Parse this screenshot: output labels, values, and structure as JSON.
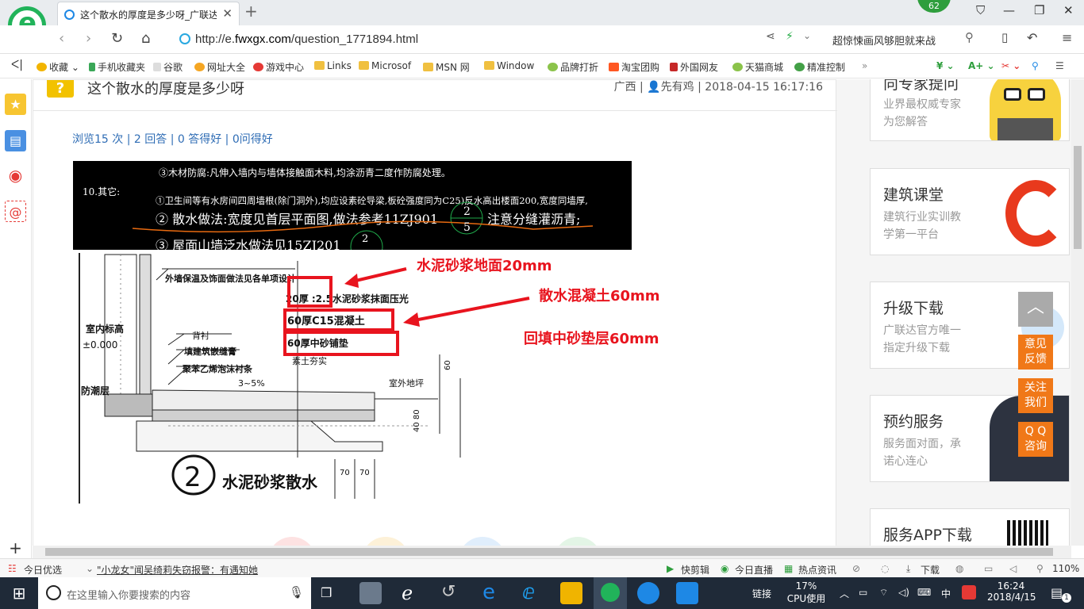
{
  "browser": {
    "tab_title": "这个散水的厚度是多少呀_广联达",
    "badge_count": "62",
    "url_prefix": "http://e.",
    "url_host": "fwxgx.com",
    "url_path": "/question_1771894.html",
    "search_text": "超惊悚画风够胆就来战"
  },
  "bookmarks": [
    {
      "label": "收藏"
    },
    {
      "label": "手机收藏夹"
    },
    {
      "label": "谷歌"
    },
    {
      "label": "网址大全"
    },
    {
      "label": "游戏中心"
    },
    {
      "label": "Links"
    },
    {
      "label": "Microsof"
    },
    {
      "label": "MSN 网"
    },
    {
      "label": "Window"
    },
    {
      "label": "品牌打折"
    },
    {
      "label": "淘宝团购"
    },
    {
      "label": "外国网友"
    },
    {
      "label": "天猫商城"
    },
    {
      "label": "精准控制"
    }
  ],
  "question": {
    "icon": "?",
    "title": "这个散水的厚度是多少呀",
    "region": "广西",
    "user": "先有鸡",
    "datetime": "2018-04-15 16:17:16",
    "stats": "浏览15 次 | 2 回答 | 0 答得好 | 0问得好"
  },
  "drawing": {
    "top_lines": [
      "③木材防腐:凡伸入墙内与墙体接触面木料,均涂沥青二度作防腐处理。",
      "10.其它:",
      "①卫生间等有水房间四周墙根(除门洞外),均应设素砼导梁,板砼强度同为C25)反水高出楼面200,宽度同墙厚,",
      "② 散水做法:宽度见首层平面图,做法参考11ZJ901",
      "注意分缝灌沥青;",
      "③ 屋面山墙泛水做法见15ZJ201"
    ],
    "ref_num": "2",
    "ref_den": "5",
    "ref2_num": "2",
    "detail_labels": {
      "wall_note": "外墙保温及饰面做法见各单项设计",
      "layer1": "20厚 :2.5水泥砂浆抹面压光",
      "layer2": "60厚C15混凝土",
      "layer3": "60厚中砂铺垫",
      "soil": "素土夯实",
      "indoor": "室内标高",
      "zero": "±0.000",
      "damp": "防潮层",
      "backing": "背衬",
      "sealant": "填建筑嵌缝膏",
      "foam": "聚苯乙烯泡沫衬条",
      "slope": "3~5%",
      "outdoor": "室外地坪",
      "dim1": "70",
      "dim2": "70",
      "dim_right1": "60",
      "dim_right2": "40 80",
      "circle_num": "2",
      "caption": "水泥砂浆散水"
    },
    "annotations": {
      "a1": "水泥砂浆地面20mm",
      "a2": "散水混凝土60mm",
      "a3": "回填中砂垫层60mm"
    },
    "red": "#e8141e"
  },
  "sidebar": {
    "cards": [
      {
        "title": "向专家提问",
        "sub1": "业界最权威专家",
        "sub2": "为您解答"
      },
      {
        "title": "建筑课堂",
        "sub1": "建筑行业实训教",
        "sub2": "学第一平台"
      },
      {
        "title": "升级下载",
        "sub1": "广联达官方唯一",
        "sub2": "指定升级下载"
      },
      {
        "title": "预约服务",
        "sub1": "服务面对面，承",
        "sub2": "诺心连心"
      },
      {
        "title": "服务APP下载"
      }
    ],
    "float_buttons": [
      {
        "l1": "意见",
        "l2": "反馈"
      },
      {
        "l1": "关注",
        "l2": "我们"
      },
      {
        "l1": "Q Q",
        "l2": "咨询"
      }
    ]
  },
  "statusbar": {
    "left": "今日优选",
    "news": "\"小龙女\"闻吴绮莉失窃报警：有遇知她",
    "items": [
      "快剪辑",
      "今日直播",
      "热点资讯",
      "下载"
    ],
    "zoom": "110%"
  },
  "taskbar": {
    "search_placeholder": "在这里输入你要搜索的内容",
    "link": "链接",
    "cpu_pct": "17%",
    "cpu_label": "CPU使用",
    "ime": "中",
    "time": "16:24",
    "date": "2018/4/15",
    "notif": "1"
  },
  "colors": {
    "accent": "#21b35a",
    "link": "#2f6db5",
    "orange": "#f07818"
  }
}
